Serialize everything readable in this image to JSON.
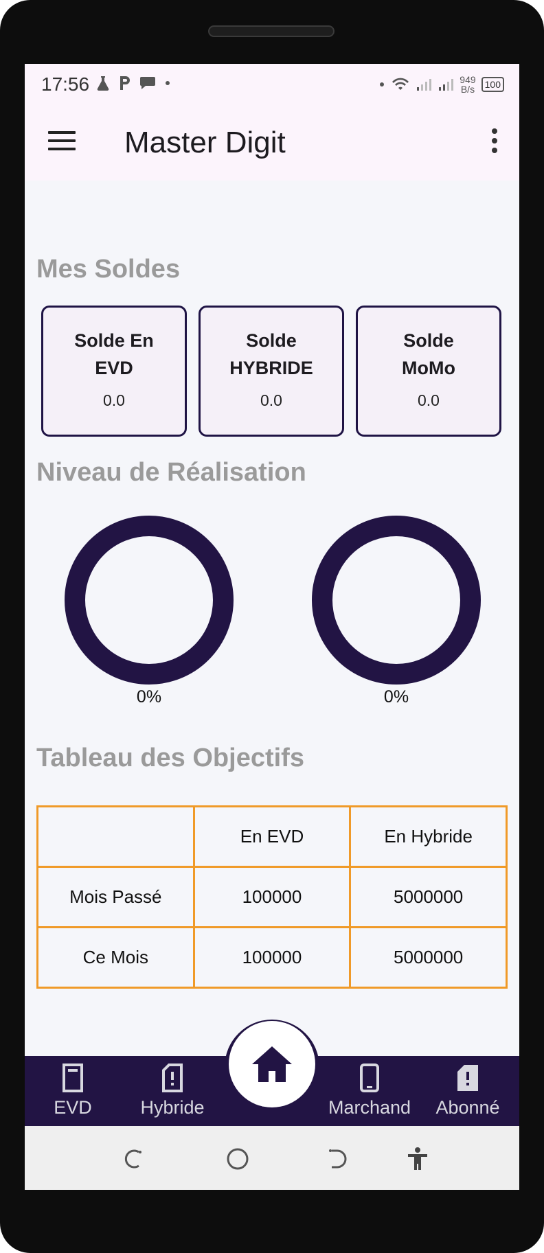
{
  "status": {
    "time": "17:56",
    "net_speed_value": "949",
    "net_speed_unit": "B/s",
    "battery": "100"
  },
  "app_bar": {
    "title": "Master Digit"
  },
  "sections": {
    "balances_title": "Mes Soldes",
    "achievement_title": "Niveau de Réalisation",
    "objectives_title": "Tableau des Objectifs"
  },
  "balances": [
    {
      "line1": "Solde En",
      "line2": "EVD",
      "value": "0.0"
    },
    {
      "line1": "Solde",
      "line2": "HYBRIDE",
      "value": "0.0"
    },
    {
      "line1": "Solde",
      "line2": "MoMo",
      "value": "0.0"
    }
  ],
  "gauges": [
    {
      "label": "0%",
      "progress": 0
    },
    {
      "label": "0%",
      "progress": 0
    }
  ],
  "objectives": {
    "headers": [
      "",
      "En EVD",
      "En Hybride"
    ],
    "rows": [
      [
        "Mois Passé",
        "100000",
        "5000000"
      ],
      [
        "Ce Mois",
        "100000",
        "5000000"
      ]
    ]
  },
  "bottom_nav": {
    "items": [
      {
        "label": "EVD",
        "icon": "sim-card-icon"
      },
      {
        "label": "Hybride",
        "icon": "sim-card-alert-icon"
      },
      {
        "label": "Marchand",
        "icon": "smartphone-icon"
      },
      {
        "label": "Abonné",
        "icon": "sim-card-alert-filled-icon"
      }
    ],
    "center_icon": "home-icon"
  },
  "colors": {
    "primary_dark": "#221444",
    "table_border": "#f09a28",
    "section_title": "#9a9a9a",
    "app_bar_bg": "#fcf4fc"
  }
}
